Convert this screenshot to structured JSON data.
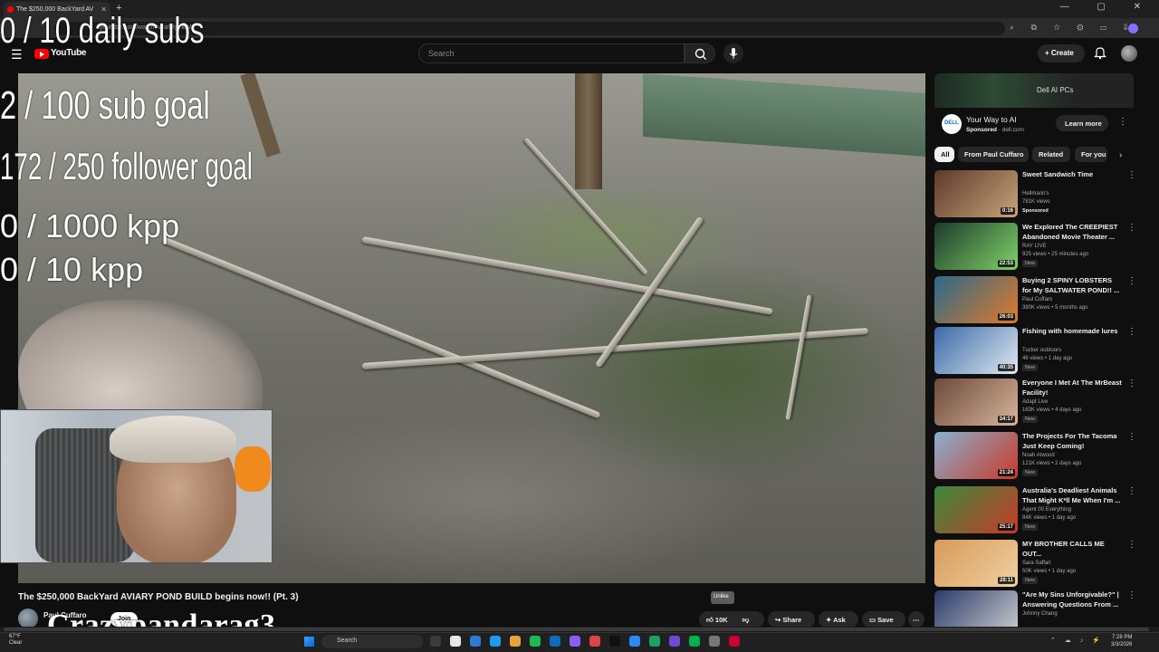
{
  "browser": {
    "tab_title": "The $250,000 BackYard AV",
    "new_tab": "+",
    "window_controls": "— ▢ ✕",
    "url": "youtube.com/watch?v=aWgInbM"
  },
  "header": {
    "logo_text": "YouTube",
    "search_placeholder": "Search",
    "create_label": "Create"
  },
  "overlays": {
    "daily_subs": "0 / 10 daily subs",
    "sub_goal": "2 / 100 sub goal",
    "follower_goal": "172 / 250 follower goal",
    "kpp_1000": "0 / 1000 kpp",
    "kpp_10": "0 / 10 kpp",
    "handle": "Crazypandarag3"
  },
  "video": {
    "title": "The $250,000 BackYard AVIARY POND BUILD begins now!! (Pt. 3)",
    "channel": "Paul Cuffaro",
    "join_label": "Join",
    "tooltip": "Unlike",
    "likes": "10K",
    "share_label": "Share",
    "ask_label": "Ask",
    "save_label": "Save"
  },
  "ad": {
    "banner_text": "Dell AI PCs",
    "logo_text": "DELL",
    "title": "Your Way to AI",
    "sponsored": "Sponsored",
    "domain": "dell.com",
    "cta": "Learn more"
  },
  "chips": [
    "All",
    "From Paul Cuffaro",
    "Related",
    "For you"
  ],
  "recommendations": [
    {
      "title": "Sweet Sandwich Time",
      "channel": "Hellmann's",
      "meta": "781K views",
      "badge": "Sponsored",
      "duration": "0:16",
      "colors": [
        "#5b3a2a",
        "#c9a37a"
      ]
    },
    {
      "title": "We Explored The CREEPIEST Abandoned Movie Theater ...",
      "channel": "RAY LIVE",
      "meta": "925 views • 25 minutes ago",
      "badge": "New",
      "duration": "22:53",
      "colors": [
        "#1d3a2a",
        "#7fd36a"
      ]
    },
    {
      "title": "Buying 2 SPINY LOBSTERS for My SALTWATER POND!! ...",
      "channel": "Paul Cuffaro",
      "meta": "380K views • 5 months ago",
      "badge": "",
      "duration": "26:03",
      "colors": [
        "#2a6a8a",
        "#e07a2a"
      ]
    },
    {
      "title": "Fishing with homemade lures",
      "channel": "Tucker outdoors",
      "meta": "46 views • 1 day ago",
      "badge": "New",
      "duration": "40:35",
      "colors": [
        "#3a6aa8",
        "#dfe8f0"
      ]
    },
    {
      "title": "Everyone I Met At The MrBeast Facility!",
      "channel": "Adapt Live",
      "meta": "163K views • 4 days ago",
      "badge": "New",
      "duration": "34:17",
      "colors": [
        "#6a4a3a",
        "#d9b49a"
      ]
    },
    {
      "title": "The Projects For The Tacoma Just Keep Coming!",
      "channel": "Noah Atwood",
      "meta": "121K views • 2 days ago",
      "badge": "New",
      "duration": "21:24",
      "colors": [
        "#8ab0d0",
        "#c83a2a"
      ]
    },
    {
      "title": "Australia's Deadliest Animals That Might K*ll Me When I'm ...",
      "channel": "Agent 00 Everything",
      "meta": "84K views • 1 day ago",
      "badge": "New",
      "duration": "25:17",
      "colors": [
        "#3a8a3a",
        "#c83a2a"
      ]
    },
    {
      "title": "MY BROTHER CALLS ME OUT...",
      "channel": "Sara Saffari",
      "meta": "50K views • 1 day ago",
      "badge": "New",
      "duration": "28:11",
      "colors": [
        "#d89a5a",
        "#f0d0a0"
      ]
    },
    {
      "title": "\"Are My Sins Unforgivable?\" | Answering Questions From ...",
      "channel": "Johnny Chang",
      "meta": "",
      "badge": "",
      "duration": "",
      "colors": [
        "#2a3a6a",
        "#d0d0d0"
      ]
    }
  ],
  "taskbar": {
    "weather_temp": "67°F",
    "weather_desc": "Clear",
    "search_placeholder": "Search",
    "time": "7:28 PM",
    "date": "3/3/2026"
  }
}
